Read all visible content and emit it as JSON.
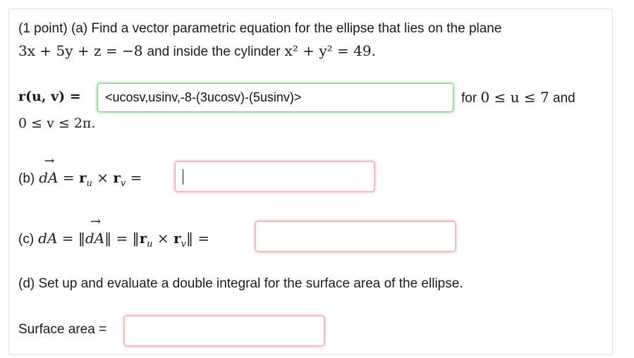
{
  "problem": {
    "part_a_intro": "(1 point) (a) Find a vector parametric equation for the ellipse that lies on the plane",
    "plane_eq": "3x + 5y + z = −8",
    "and_inside": "and inside the cylinder",
    "cylinder_eq": "x² + y² = 49.",
    "r_label": "r(u, v) =",
    "r_value": "<ucosv,usinv,-8-(3ucosv)-(5usinv)>",
    "for_text": "for",
    "u_range": "0 ≤ u ≤ 7",
    "and_text": "and",
    "v_range": "0 ≤ v ≤ 2π.",
    "part_b_label": "(b)",
    "part_b_value": "",
    "part_c_label": "(c)",
    "part_c_value": "",
    "part_d": "(d) Set up and evaluate a double integral for the surface area of the ellipse.",
    "surface_area_label": "Surface area =",
    "surface_area_value": ""
  }
}
